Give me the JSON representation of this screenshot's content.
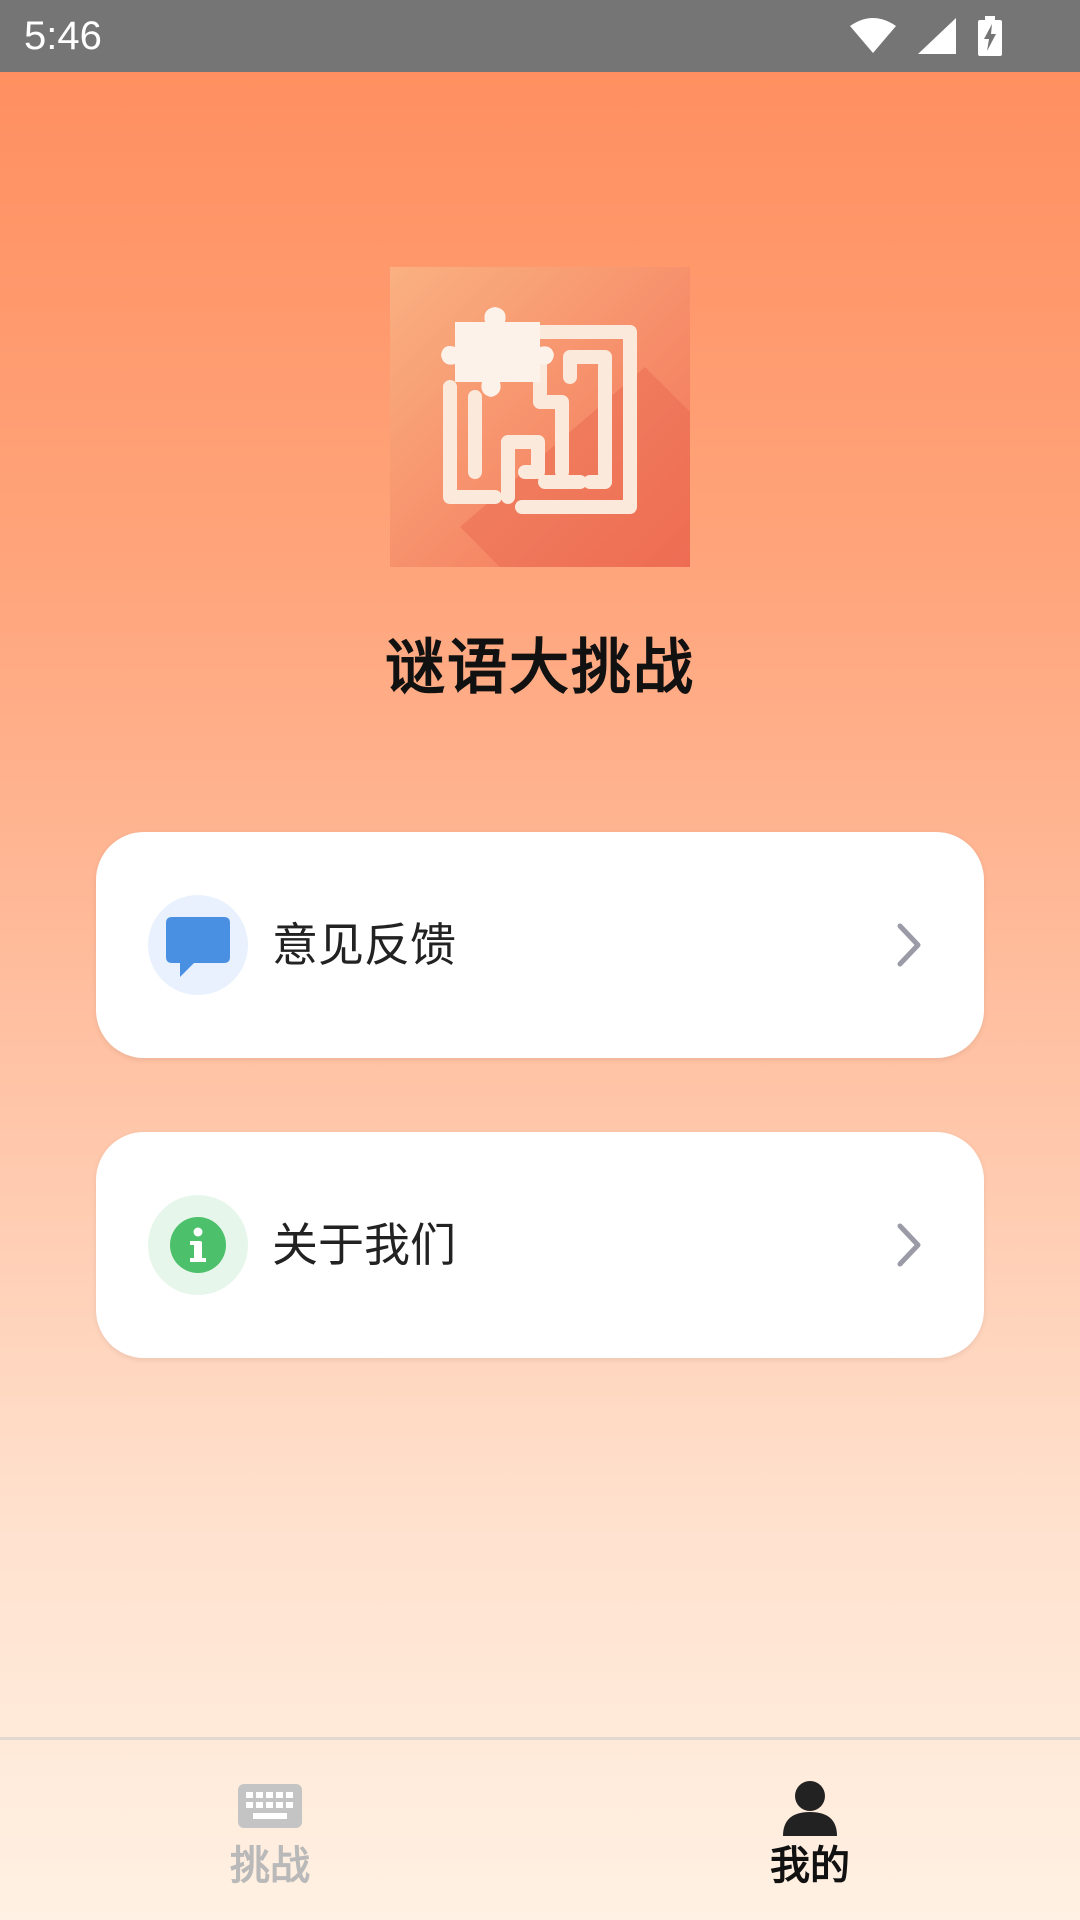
{
  "status_bar": {
    "time": "5:46"
  },
  "app": {
    "title": "谜语大挑战",
    "icon": "puzzle-maze-icon"
  },
  "menu": [
    {
      "label": "意见反馈",
      "icon": "chat-bubble-icon",
      "icon_color": "#4a90e2"
    },
    {
      "label": "关于我们",
      "icon": "info-icon",
      "icon_color": "#4cc06a"
    }
  ],
  "bottom_nav": {
    "items": [
      {
        "label": "挑战",
        "icon": "keyboard-icon",
        "active": false
      },
      {
        "label": "我的",
        "icon": "person-icon",
        "active": true
      }
    ]
  },
  "colors": {
    "background_top": "#ff8c5c",
    "background_bottom": "#fff1e3",
    "icon_orange": "#f47b56",
    "nav_inactive": "#b9b9b9",
    "nav_active": "#111111"
  }
}
